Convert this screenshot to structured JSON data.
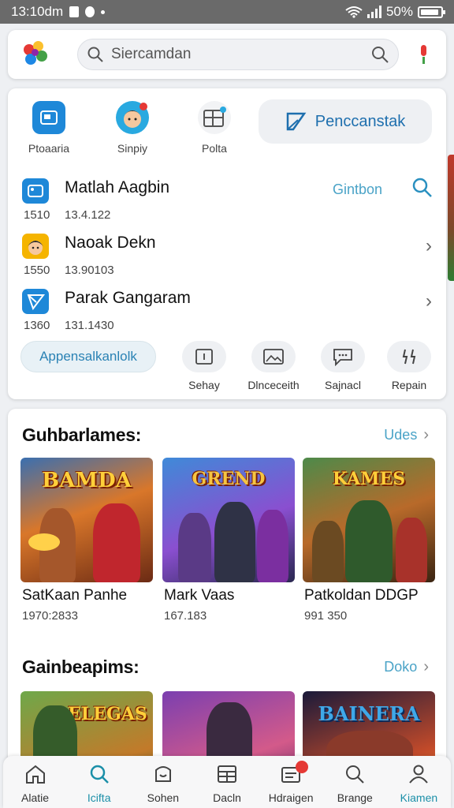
{
  "status_bar": {
    "time": "13:10dm",
    "battery": "50%"
  },
  "search": {
    "placeholder": "Siercamdan"
  },
  "shortcuts": [
    {
      "label": "Ptoaaria",
      "icon": "tablet-icon"
    },
    {
      "label": "Sinpiy",
      "icon": "avatar-icon"
    },
    {
      "label": "Polta",
      "icon": "grid-icon"
    }
  ],
  "primary_button": {
    "label": "Penccanstak",
    "icon": "pencil-icon"
  },
  "list_rows": [
    {
      "title": "Matlah Aagbin",
      "num": "1510",
      "date": "13.4.122",
      "link": "Gintbon"
    },
    {
      "title": "Naoak Dekn",
      "num": "1550",
      "date": "13.90103"
    },
    {
      "title": "Parak Gangaram",
      "num": "1360",
      "date": "131.1430"
    }
  ],
  "pill": {
    "label": "Appensalkanlolk"
  },
  "actions": [
    {
      "label": "Sehay",
      "icon": "square-icon"
    },
    {
      "label": "Dlnceceith",
      "icon": "image-icon"
    },
    {
      "label": "Sajnacl",
      "icon": "chat-icon"
    },
    {
      "label": "Repain",
      "icon": "tools-icon"
    }
  ],
  "section1": {
    "title": "Guhbarlames:",
    "more": "Udes",
    "tiles": [
      {
        "banner": "BAMDA",
        "title": "SatKaan Panhe",
        "sub": "1970:2833"
      },
      {
        "banner": "GREND",
        "title": "Mark Vaas",
        "sub": "167.183"
      },
      {
        "banner": "KAMES",
        "title": "Patkoldan DDGP",
        "sub": "991 350"
      }
    ]
  },
  "section2": {
    "title": "Gainbeapims:",
    "more": "Doko",
    "tiles": [
      {
        "banner": "ELEGAS"
      },
      {
        "banner": ""
      },
      {
        "banner": "BAINERA"
      }
    ]
  },
  "bottom_nav": [
    {
      "label": "Alatie",
      "icon": "home-icon"
    },
    {
      "label": "Icifta",
      "icon": "search-icon"
    },
    {
      "label": "Sohen",
      "icon": "bag-icon"
    },
    {
      "label": "Dacln",
      "icon": "calendar-icon"
    },
    {
      "label": "Hdraigen",
      "icon": "inbox-icon"
    },
    {
      "label": "Brange",
      "icon": "search-icon"
    },
    {
      "label": "Kiamen",
      "icon": "person-icon"
    }
  ]
}
